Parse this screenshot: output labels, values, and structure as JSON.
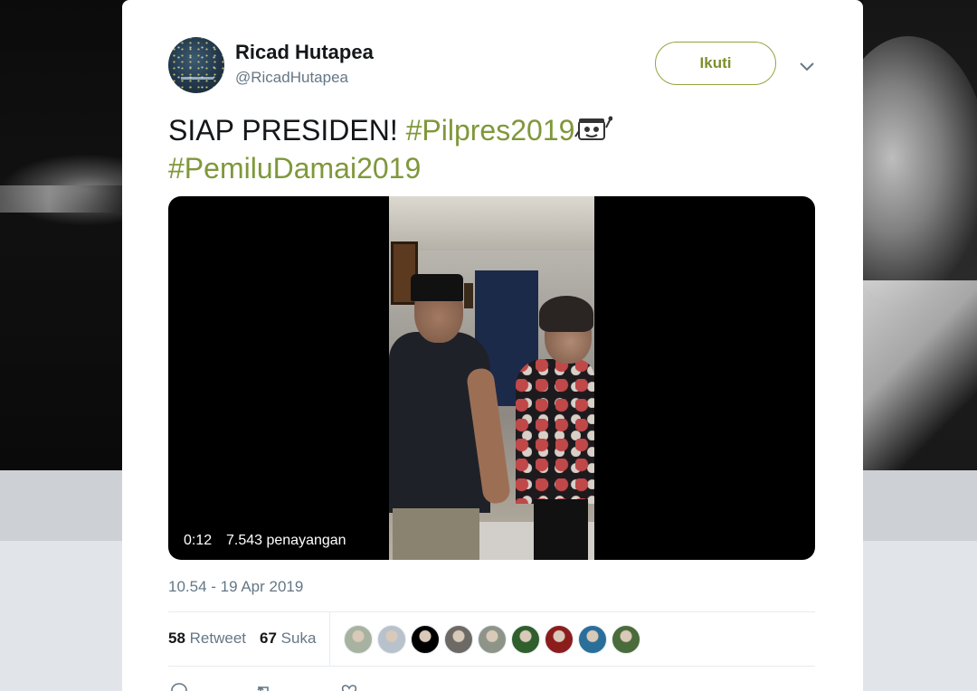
{
  "profile": {
    "display_name": "Ricad Hutapea",
    "handle": "@RicadHutapea",
    "follow_label": "Ikuti"
  },
  "tweet": {
    "text_plain": "SIAP PRESIDEN! ",
    "hashtag_1": "#Pilpres2019",
    "hashtag_2": "#PemiluDamai2019",
    "timestamp": "10.54 - 19 Apr 2019"
  },
  "video": {
    "duration": "0:12",
    "views": "7.543 penayangan"
  },
  "stats": {
    "retweet_count": "58",
    "retweet_label": "Retweet",
    "like_count": "67",
    "like_label": "Suka"
  },
  "likers": [
    {
      "name": "liker-1",
      "color": "#a7b3a0"
    },
    {
      "name": "liker-2",
      "color": "#b8c2cc"
    },
    {
      "name": "liker-3",
      "color": "#000000"
    },
    {
      "name": "liker-4",
      "color": "#6d6a66"
    },
    {
      "name": "liker-5",
      "color": "#8e9488"
    },
    {
      "name": "liker-6",
      "color": "#2f5f2c"
    },
    {
      "name": "liker-7",
      "color": "#8b1d1d"
    },
    {
      "name": "liker-8",
      "color": "#2a6f9a"
    },
    {
      "name": "liker-9",
      "color": "#4a6b3a"
    }
  ],
  "colors": {
    "accent": "#7f983a",
    "muted_text": "#657786"
  },
  "icons": [
    "chevron-down-icon",
    "emoji-icon",
    "reply-icon",
    "retweet-icon",
    "like-icon"
  ]
}
